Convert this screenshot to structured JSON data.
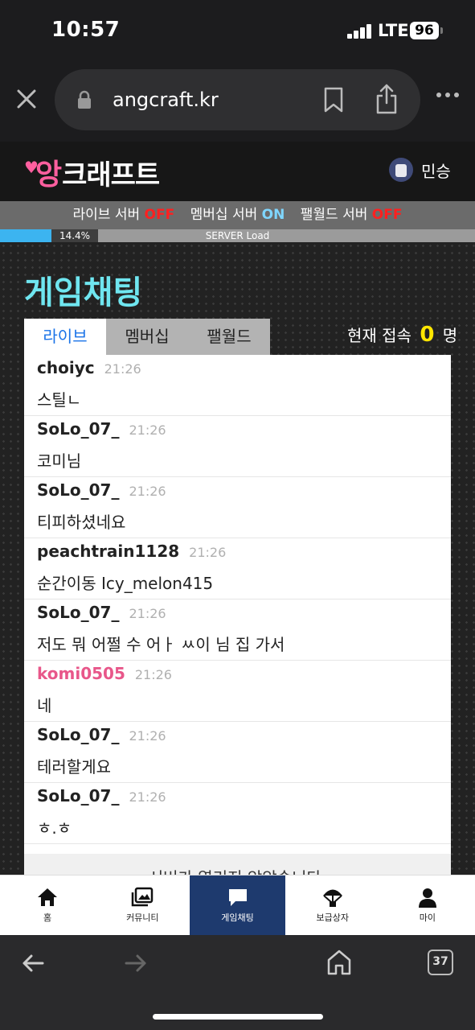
{
  "status_bar": {
    "time": "10:57",
    "network": "LTE",
    "battery": "96"
  },
  "browser": {
    "url": "angcraft.kr",
    "tab_count": "37"
  },
  "site": {
    "logo_first": "앙",
    "logo_rest": "크래프트",
    "username": "민승"
  },
  "servers": {
    "live_label": "라이브 서버",
    "live_status": "OFF",
    "membership_label": "멤버십 서버",
    "membership_status": "ON",
    "palworld_label": "팰월드 서버",
    "palworld_status": "OFF"
  },
  "server_load": {
    "percent_label": "14.4%",
    "fraction": 0.144,
    "label": "SERVER Load"
  },
  "page": {
    "title": "게임채팅",
    "tabs": [
      "라이브",
      "멤버십",
      "팰월드"
    ],
    "online_label": "현재 접속",
    "online_count": "0",
    "online_unit": "명",
    "server_closed_message": "서버가 열리지 않았습니다."
  },
  "messages": [
    {
      "name": "choiyc",
      "time": "21:26",
      "text": "스틸ㄴ",
      "highlight": false
    },
    {
      "name": "SoLo_07_",
      "time": "21:26",
      "text": "코미님",
      "highlight": false
    },
    {
      "name": "SoLo_07_",
      "time": "21:26",
      "text": "티피하셨네요",
      "highlight": false
    },
    {
      "name": "peachtrain1128",
      "time": "21:26",
      "text": "순간이동 Icy_melon415",
      "highlight": false
    },
    {
      "name": "SoLo_07_",
      "time": "21:26",
      "text": "저도 뭐 어쩔 수 어ㅏ ㅆ이 님 집 가서",
      "highlight": false
    },
    {
      "name": "komi0505",
      "time": "21:26",
      "text": "네",
      "highlight": true
    },
    {
      "name": "SoLo_07_",
      "time": "21:26",
      "text": "테러할게요",
      "highlight": false
    },
    {
      "name": "SoLo_07_",
      "time": "21:26",
      "text": "ㅎ.ㅎ",
      "highlight": false
    }
  ],
  "bottom_nav": {
    "home": "홈",
    "community": "커뮤니티",
    "game_chat": "게임채팅",
    "supply_box": "보급상자",
    "my": "마이"
  },
  "colors": {
    "accent_title": "#6fe6f0",
    "active_nav": "#1e3a6e",
    "off": "#ff2020",
    "on": "#7fd6ff",
    "highlight_name": "#e8578a"
  }
}
